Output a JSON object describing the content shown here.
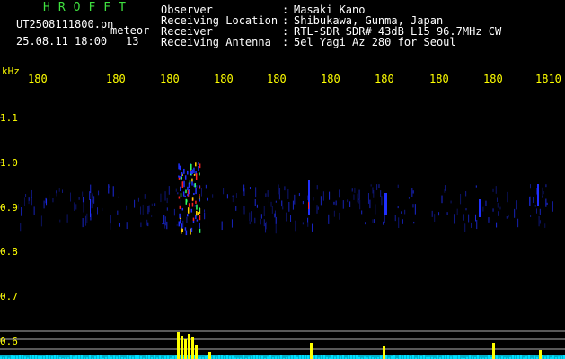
{
  "header": {
    "title": "HROFFT",
    "filename": "UT2508111800.pn",
    "tag": "meteor",
    "datetime": "25.08.11 18:00",
    "count": "13"
  },
  "info": [
    {
      "label": "Observer",
      "value": "Masaki Kano"
    },
    {
      "label": "Receiving Location",
      "value": "Shibukawa, Gunma, Japan"
    },
    {
      "label": "Receiver",
      "value": "RTL-SDR SDR# 43dB L15 96.7MHz CW"
    },
    {
      "label": "Receiving Antenna",
      "value": "5el Yagi Az 280 for Seoul"
    }
  ],
  "axis": {
    "y_unit": "kHz",
    "y_ticks": [
      "1.1",
      "1.0",
      "0.9",
      "0.8",
      "0.7",
      "0.6"
    ],
    "x_ticks": [
      "180",
      "180",
      "180",
      "180",
      "180",
      "180",
      "180",
      "180",
      "180",
      "1810"
    ]
  },
  "colors": {
    "header_green": "#3fe13f",
    "text_white": "#ffffff",
    "axis_yellow": "#ffff00",
    "echo_red": "#ff2020",
    "signal_blue": "#2030ff",
    "level_cyan": "#00e0ff"
  }
}
